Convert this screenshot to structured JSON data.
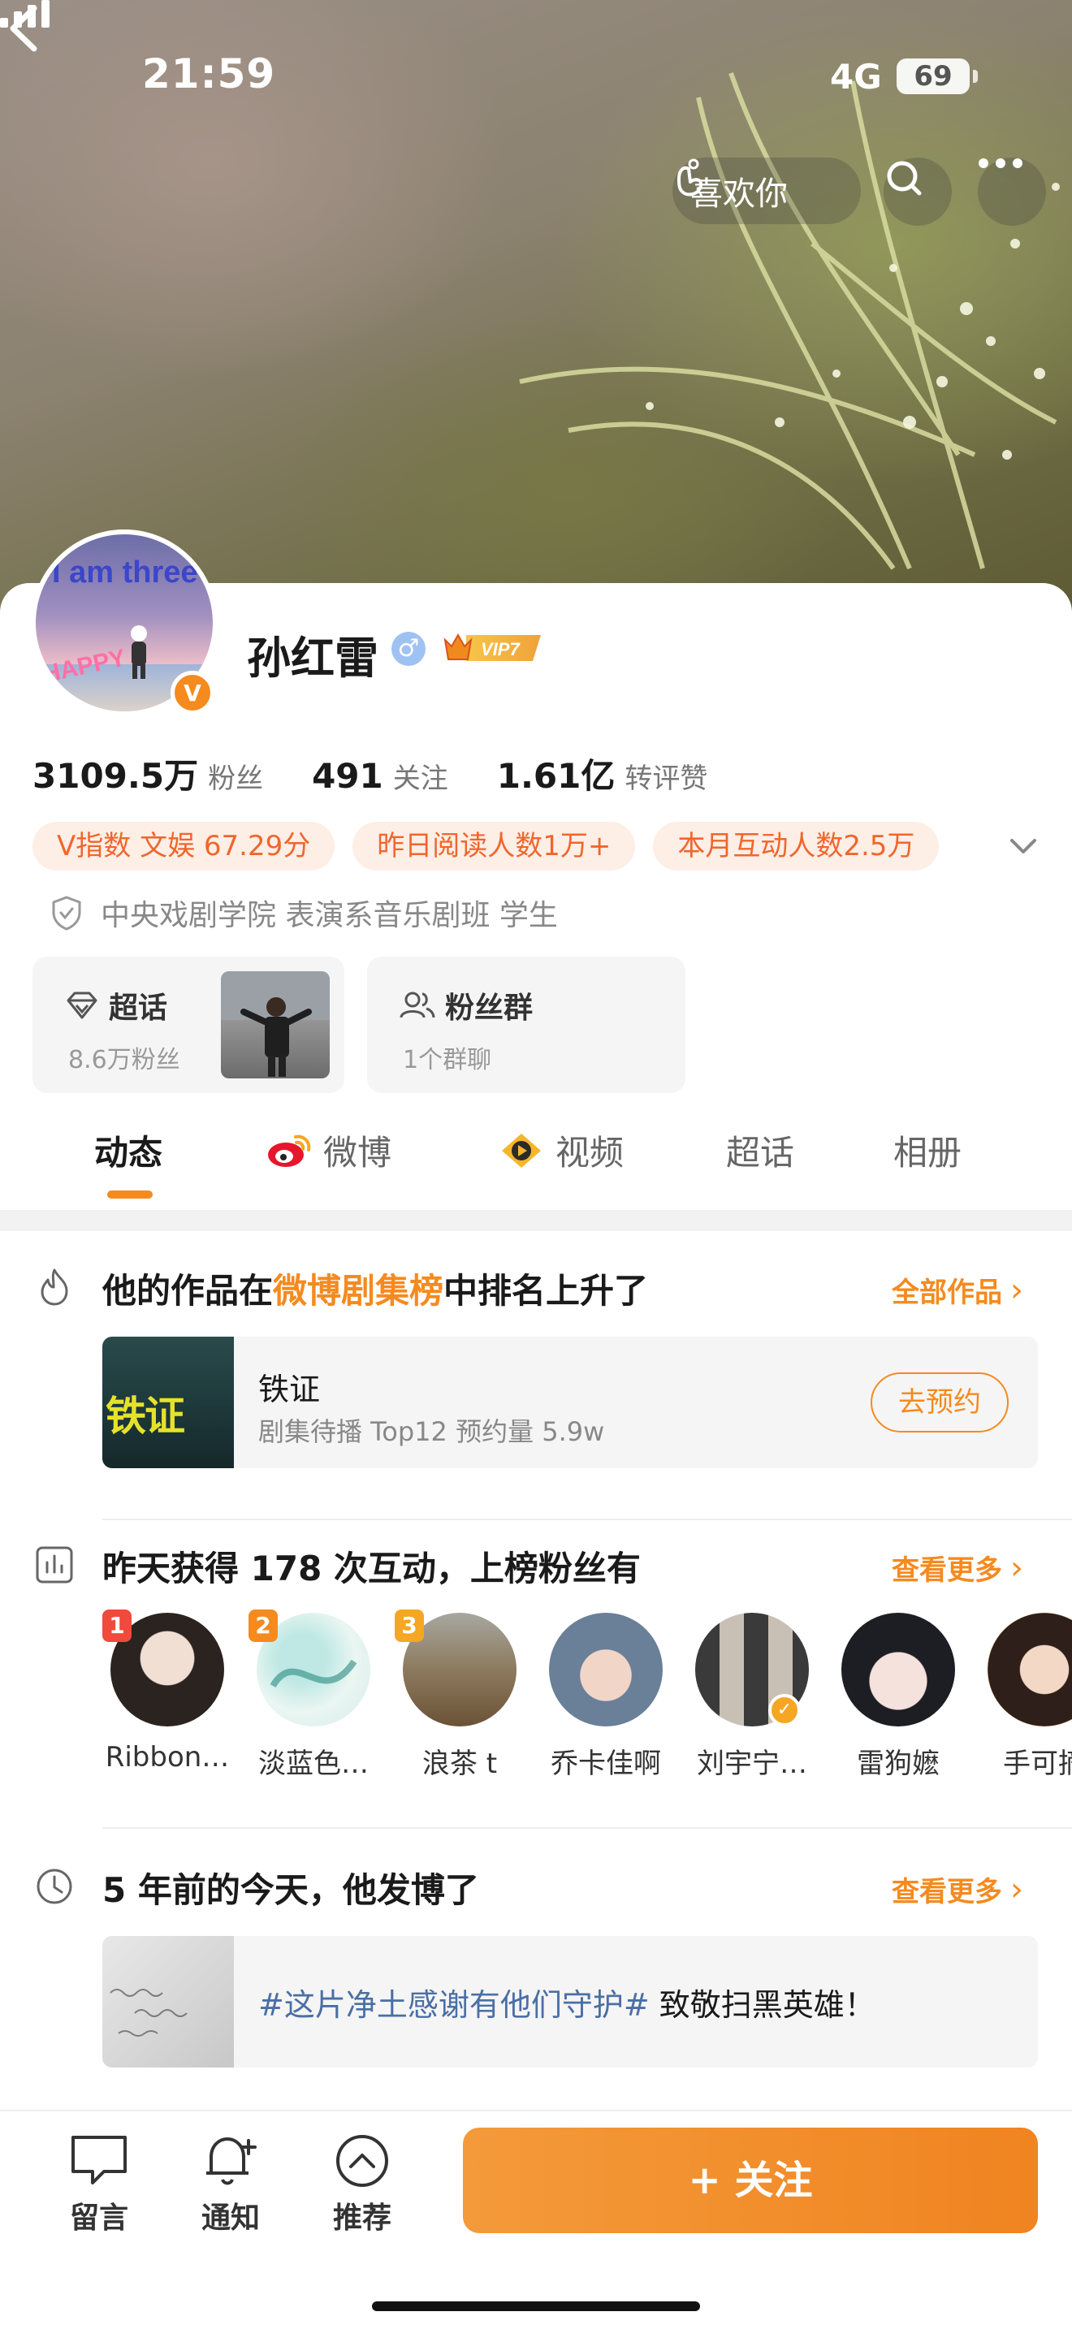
{
  "status_bar": {
    "time": "21:59",
    "network": "4G",
    "battery": "69"
  },
  "header": {
    "like_label": "喜欢你"
  },
  "profile": {
    "avatar_text_top": "I am three",
    "avatar_text_bottom": "HAPPY",
    "verified_badge": "V",
    "name": "孙红雷",
    "gender_symbol": "♂",
    "vip_label": "VIP7",
    "stats": [
      {
        "num": "3109.5万",
        "label": "粉丝"
      },
      {
        "num": "491",
        "label": "关注"
      },
      {
        "num": "1.61亿",
        "label": "转评赞"
      }
    ],
    "chips": [
      "V指数 文娱 67.29分",
      "昨日阅读人数1万+",
      "本月互动人数2.5万"
    ],
    "education": "中央戏剧学院 表演系音乐剧班 学生"
  },
  "tiles": {
    "supertopic": {
      "title": "超话",
      "sub": "8.6万粉丝"
    },
    "fangroup": {
      "title": "粉丝群",
      "sub": "1个群聊"
    }
  },
  "tabs": [
    "动态",
    "微博",
    "视频",
    "超话",
    "相册"
  ],
  "ranking_section": {
    "title_prefix": "他的作品在",
    "title_highlight": "微博剧集榜",
    "title_suffix": "中排名上升了",
    "more": "全部作品",
    "work": {
      "thumb_text": "铁证",
      "name": "铁证",
      "sub": "剧集待播 Top12 预约量 5.9w",
      "button": "去预约"
    }
  },
  "fans_section": {
    "title": "昨天获得 178 次互动，上榜粉丝有",
    "more": "查看更多",
    "fans": [
      {
        "rank": "1",
        "name": "Ribbon…"
      },
      {
        "rank": "2",
        "name": "淡蓝色…"
      },
      {
        "rank": "3",
        "name": "浪茶 t"
      },
      {
        "rank": "",
        "name": "乔卡佳啊"
      },
      {
        "rank": "",
        "name": "刘宇宁…"
      },
      {
        "rank": "",
        "name": "雷狗嬷"
      },
      {
        "rank": "",
        "name": "手可摘"
      }
    ],
    "rank_colors": [
      "#f04a3c",
      "#f58a1f",
      "#f5a623"
    ]
  },
  "past_section": {
    "title": "5 年前的今天，他发博了",
    "more": "查看更多",
    "topic": "#这片净土感谢有他们守护#",
    "text": " 致敬扫黑英雄！"
  },
  "bottom_bar": {
    "items": [
      "留言",
      "通知",
      "推荐"
    ],
    "follow": "+ 关注"
  },
  "colors": {
    "accent": "#f58a1f",
    "chip_bg": "#fdeee6",
    "chip_text": "#f0662c",
    "topic_blue": "#4a6fa5"
  }
}
